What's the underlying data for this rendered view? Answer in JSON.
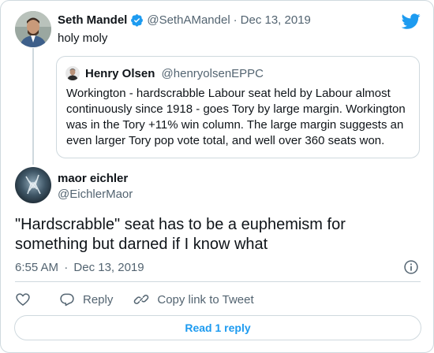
{
  "parent_tweet": {
    "author_name": "Seth Mandel",
    "handle": "@SethAMandel",
    "date": "Dec 13, 2019",
    "text": "holy moly",
    "separator": "·"
  },
  "quoted_tweet": {
    "author_name": "Henry Olsen",
    "handle": "@henryolsenEPPC",
    "text": "Workington - hardscrabble Labour seat held by Labour almost continuously since 1918 - goes Tory by large margin. Workington was in the Tory +11% win column. The large margin suggests an even larger Tory pop vote total, and well over 360 seats won."
  },
  "main_tweet": {
    "author_name": "maor eichler",
    "handle": "@EichlerMaor",
    "text": "\"Hardscrabble\" seat has to be a euphemism for something but darned if I know what",
    "time": "6:55 AM",
    "date": "Dec 13, 2019",
    "separator": "·"
  },
  "actions": {
    "reply_label": "Reply",
    "copy_link_label": "Copy link to Tweet",
    "read_replies_label": "Read 1 reply"
  },
  "colors": {
    "accent": "#1d9bf0",
    "muted": "#536471",
    "border": "#cfd9de"
  },
  "icons": [
    "twitter-logo-icon",
    "verified-badge-icon",
    "info-icon",
    "heart-icon",
    "reply-icon",
    "link-icon"
  ]
}
